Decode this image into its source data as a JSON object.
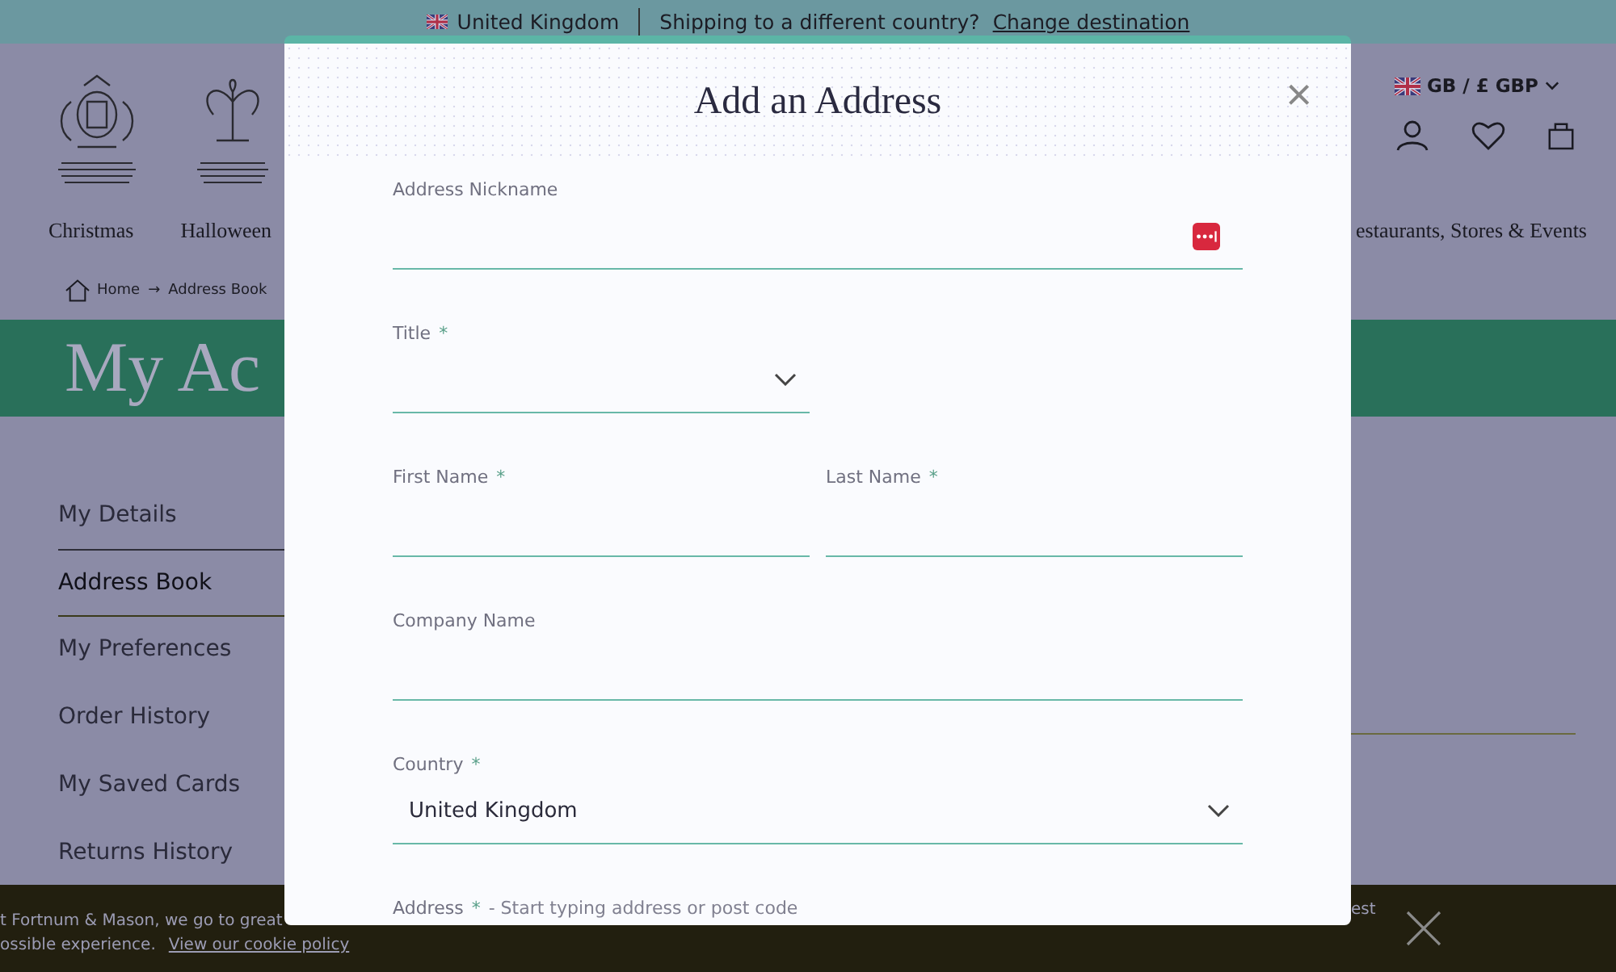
{
  "top_bar": {
    "country": "United Kingdom",
    "question": "Shipping to a different country?",
    "link": "Change destination"
  },
  "header": {
    "currency": "GB / £ GBP",
    "nav_left": [
      "Christmas",
      "Halloween"
    ],
    "nav_right": "estaurants, Stores & Events"
  },
  "breadcrumb": {
    "items": [
      "Home",
      "Address Book"
    ],
    "separator": "→"
  },
  "banner": {
    "title": "My Ac"
  },
  "sidebar": {
    "items": [
      {
        "label": "My Details",
        "selected": false
      },
      {
        "label": "Address Book",
        "selected": true
      },
      {
        "label": "My Preferences",
        "selected": false
      },
      {
        "label": "Order History",
        "selected": false
      },
      {
        "label": "My Saved Cards",
        "selected": false
      },
      {
        "label": "Returns History",
        "selected": false
      }
    ]
  },
  "modal": {
    "title": "Add an Address",
    "close": "×",
    "rows": [
      [
        {
          "kind": "text",
          "label": "Address Nickname",
          "autofill": true
        }
      ],
      [
        {
          "kind": "select",
          "label": "Title",
          "required_mark": "*",
          "half": true
        }
      ],
      [
        {
          "kind": "text",
          "label": "First Name",
          "required_mark": "*"
        },
        {
          "kind": "text",
          "label": "Last Name",
          "required_mark": "*"
        }
      ],
      [
        {
          "kind": "text",
          "label": "Company Name"
        }
      ],
      [
        {
          "kind": "select",
          "label": "Country",
          "required_mark": "*",
          "value": "United Kingdom"
        }
      ],
      [
        {
          "kind": "hint",
          "label": "Address",
          "required_mark": "*",
          "hint": "- Start typing address or post code"
        }
      ]
    ]
  },
  "cookie_bar": {
    "line_1": "t Fortnum & Mason, we go to great",
    "line_1_end": "est",
    "line_2": "ossible experience.",
    "link": "View our cookie policy"
  }
}
